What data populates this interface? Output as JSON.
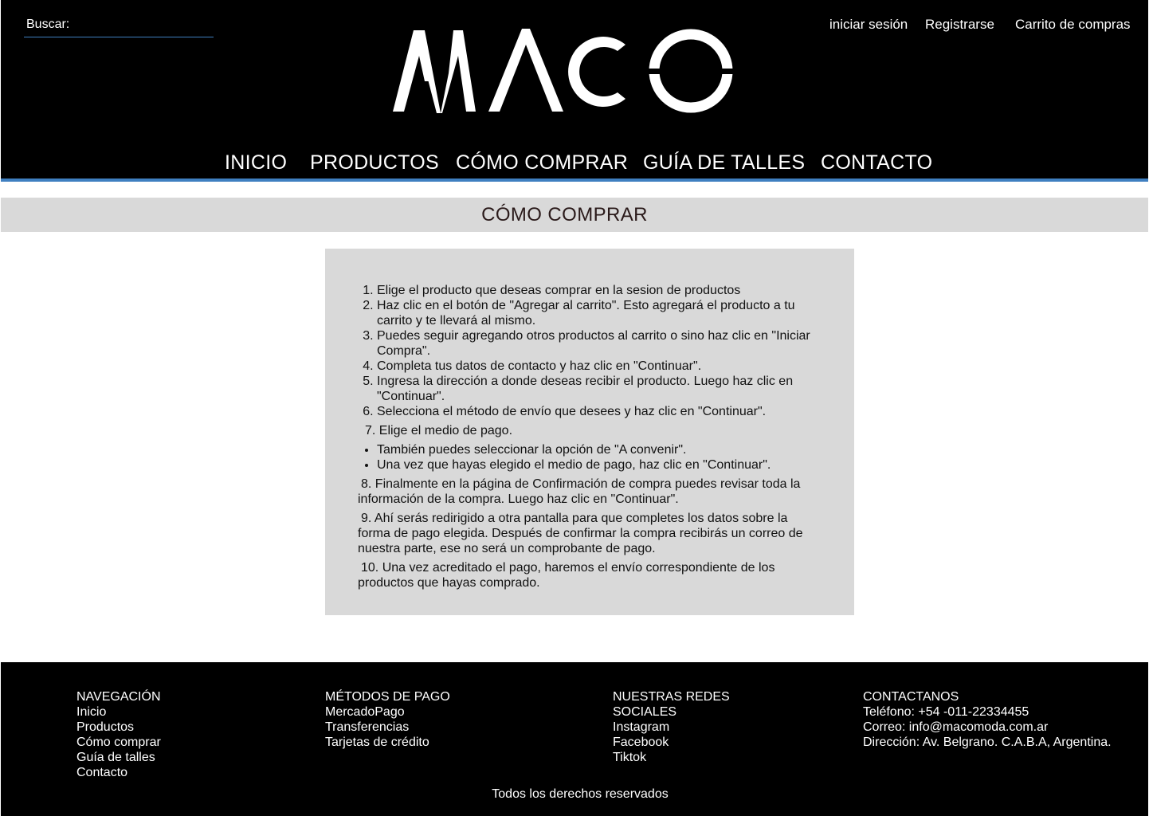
{
  "header": {
    "search_label": "Buscar:",
    "search_value": "",
    "login": "iniciar sesión",
    "register": "Registrarse",
    "cart": "Carrito de compras",
    "logo_text": "MACO",
    "logo_color": "#ffffff",
    "accent_color": "#3f7fc0"
  },
  "nav": {
    "items": [
      "INICIO",
      "PRODUCTOS",
      "CÓMO COMPRAR",
      "GUÍA DE TALLES",
      "CONTACTO"
    ]
  },
  "page_title": "CÓMO COMPRAR",
  "steps": [
    "Elige el producto que deseas comprar en la sesion de productos",
    "Haz clic en el botón de \"Agregar al carrito\". Esto agregará el producto a tu carrito y te llevará al mismo.",
    "Puedes seguir agregando otros productos al carrito o sino haz clic en \"Iniciar Compra\".",
    "Completa tus datos de contacto y haz clic en \"Continuar\".",
    "Ingresa la dirección a donde deseas recibir el producto. Luego haz clic en \"Continuar\".",
    "Selecciona el método de envío que desees y haz clic en \"Continuar\"."
  ],
  "step7": "7. Elige el medio de pago.",
  "step7_bullets": [
    "También puedes seleccionar la opción de \"A convenir\".",
    "Una vez que hayas elegido el medio de pago, haz clic en \"Continuar\"."
  ],
  "step8": "8. Finalmente en la página de Confirmación de compra puedes revisar toda la información de la compra. Luego haz clic en \"Continuar\".",
  "step9": "9. Ahí serás redirigido a otra pantalla para que completes los datos sobre la forma de pago elegida. Después de confirmar la compra recibirás un correo de nuestra parte, ese no será un comprobante de pago.",
  "step10": "10. Una vez acreditado el pago, haremos el envío correspondiente de los productos que hayas comprado.",
  "footer": {
    "nav_title": "NAVEGACIÓN",
    "nav_links": [
      "Inicio",
      "Productos",
      "Cómo comprar",
      "Guía de talles",
      "Contacto"
    ],
    "pay_title": "MÉTODOS DE PAGO",
    "pay_links": [
      "MercadoPago",
      "Transferencias",
      "Tarjetas de crédito"
    ],
    "social_title_1": "NUESTRAS REDES",
    "social_title_2": "SOCIALES",
    "social_links": [
      "Instagram",
      "Facebook",
      "Tiktok"
    ],
    "contact_title": "CONTACTANOS",
    "contact_lines": [
      "Teléfono: +54 -011-22334455",
      "Correo: info@macomoda.com.ar",
      "Dirección: Av. Belgrano. C.A.B.A, Argentina."
    ],
    "copyright": "Todos los derechos reservados"
  }
}
